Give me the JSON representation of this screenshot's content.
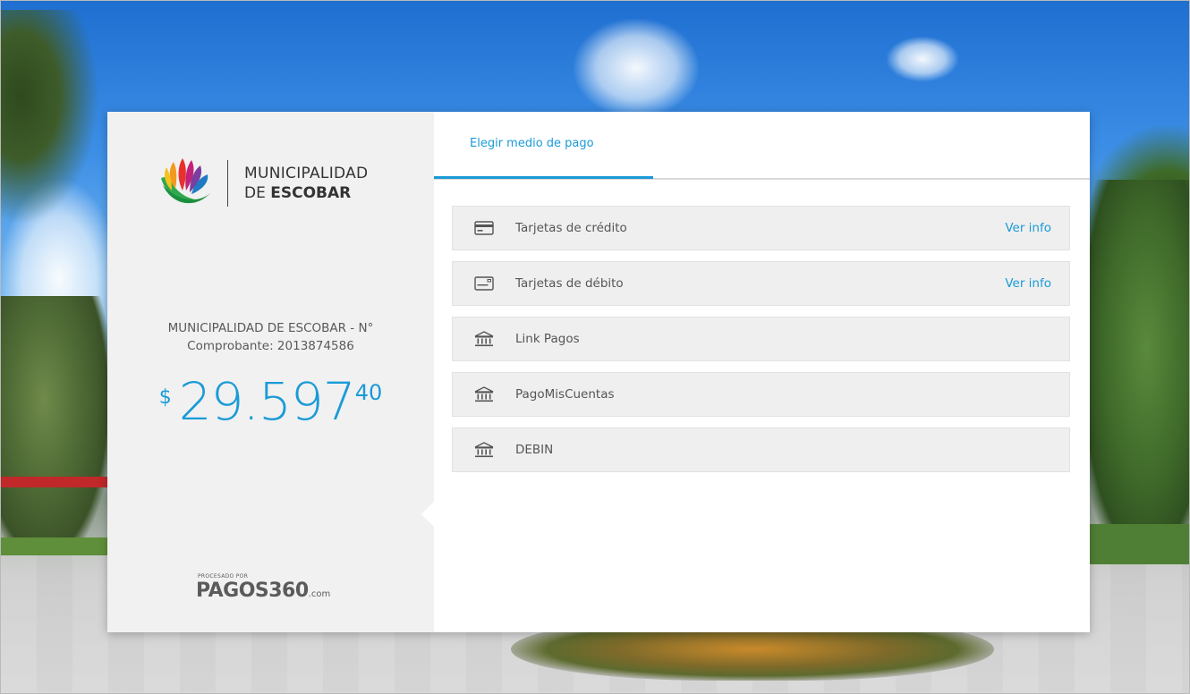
{
  "brand": {
    "line1": "MUNICIPALIDAD",
    "line2_prefix": "DE ",
    "line2_bold": "ESCOBAR"
  },
  "receipt": {
    "line1": "MUNICIPALIDAD DE ESCOBAR - N°",
    "line2": "Comprobante: 2013874586"
  },
  "amount": {
    "currency": "$",
    "integer": "29.597",
    "decimals": "40"
  },
  "powered": {
    "caption": "PROCESADO POR",
    "brand": "PAGOS360",
    "suffix": ".com"
  },
  "tabs": [
    {
      "label": "Elegir medio de pago",
      "active": true
    }
  ],
  "methods": [
    {
      "label": "Tarjetas de crédito",
      "icon": "credit-card-icon",
      "info": "Ver info"
    },
    {
      "label": "Tarjetas de débito",
      "icon": "debit-card-icon",
      "info": "Ver info"
    },
    {
      "label": "Link Pagos",
      "icon": "bank-icon",
      "info": ""
    },
    {
      "label": "PagoMisCuentas",
      "icon": "bank-icon",
      "info": ""
    },
    {
      "label": "DEBIN",
      "icon": "bank-icon",
      "info": ""
    }
  ],
  "colors": {
    "accent": "#1a9bd7",
    "panel_bg": "#f1f1f1",
    "method_bg": "#efefef"
  }
}
